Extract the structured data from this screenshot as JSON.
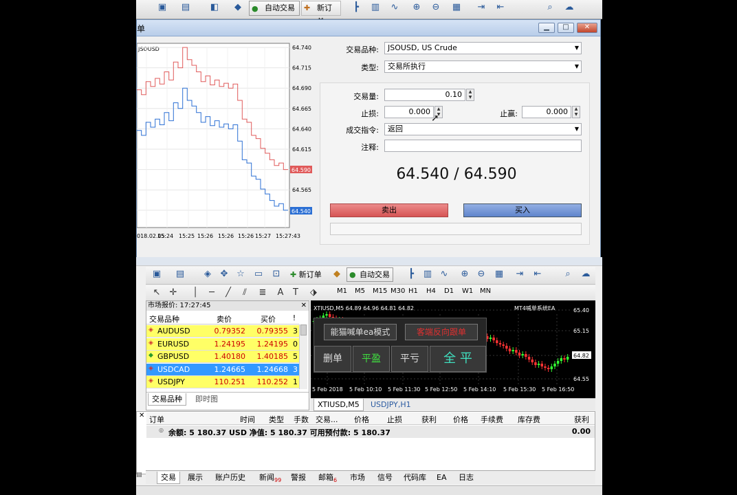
{
  "toolbar_top": {
    "autotrade": "自动交易",
    "new_order": "新订单"
  },
  "dialog": {
    "title": "单",
    "chart": {
      "symbol": "JSOUSD",
      "price_ticks": [
        "64.740",
        "64.715",
        "64.690",
        "64.665",
        "64.640",
        "64.615",
        "64.590",
        "64.565",
        "64.540"
      ],
      "time_ticks": [
        "018.02.05",
        "15:24",
        "15:25",
        "15:26",
        "15:26",
        "15:26",
        "15:27",
        "15:27:43"
      ],
      "bid_tag": "64.540",
      "ask_tag": "64.590"
    },
    "symbol_label": "交易品种:",
    "symbol_value": "JSOUSD, US Crude",
    "type_label": "类型:",
    "type_value": "交易所执行",
    "volume_label": "交易量:",
    "volume_value": "0.10",
    "sl_label": "止损:",
    "sl_value": "0.000",
    "tp_label": "止赢:",
    "tp_value": "0.000",
    "fill_label": "成交指令:",
    "fill_value": "返回",
    "comment_label": "注释:",
    "comment_value": "",
    "quote": "64.540 / 64.590",
    "sell_label": "卖出",
    "buy_label": "买入"
  },
  "terminal": {
    "toolbar": {
      "new_order": "新订单",
      "autotrade": "自动交易"
    },
    "timeframes": [
      "M1",
      "M5",
      "M15",
      "M30",
      "H1",
      "H4",
      "D1",
      "W1",
      "MN"
    ],
    "market_watch": {
      "title": "市场报价: 17:27:45",
      "headers": [
        "交易品种",
        "卖价",
        "买价",
        "!"
      ],
      "rows": [
        {
          "symbol": "AUDUSD",
          "bid": "0.79352",
          "ask": "0.79355",
          "spread": "3",
          "dir": "down"
        },
        {
          "symbol": "EURUSD",
          "bid": "1.24195",
          "ask": "1.24195",
          "spread": "0",
          "dir": "down"
        },
        {
          "symbol": "GBPUSD",
          "bid": "1.40180",
          "ask": "1.40185",
          "spread": "5",
          "dir": "up"
        },
        {
          "symbol": "USDCAD",
          "bid": "1.24665",
          "ask": "1.24668",
          "spread": "3",
          "dir": "down"
        },
        {
          "symbol": "USDJPY",
          "bid": "110.251",
          "ask": "110.252",
          "spread": "1",
          "dir": "down"
        }
      ],
      "tabs": [
        "交易品种",
        "即时图"
      ]
    },
    "chart": {
      "header": "XTIUSD,M5  64.89 64.96 64.81 64.82",
      "ea_label": "MT4喊单系统EA",
      "price_ticks": [
        "65.40",
        "65.15",
        "64.82",
        "64.55"
      ],
      "time_ticks": [
        "5 Feb 2018",
        "5 Feb 10:10",
        "5 Feb 11:30",
        "5 Feb 12:50",
        "5 Feb 14:10",
        "5 Feb 15:30",
        "5 Feb 16:50"
      ],
      "overlay": {
        "mode_btn": "能猫喊单ea模式",
        "reverse_btn": "客端反向跟单",
        "delete_btn": "删单",
        "profit_btn": "平盈",
        "loss_btn": "平亏",
        "all_close_btn": "全 平"
      },
      "tabs": [
        "XTIUSD,M5",
        "USDJPY,H1"
      ]
    },
    "orders": {
      "headers": [
        "订单",
        "时间",
        "类型",
        "手数",
        "交易...",
        "价格",
        "止损",
        "获利",
        "价格",
        "手续费",
        "库存费",
        "获利"
      ],
      "balance": "余额: 5 180.37 USD  净值: 5 180.37  可用预付款: 5 180.37",
      "balance_profit": "0.00"
    },
    "bottom_tabs": [
      "交易",
      "展示",
      "账户历史",
      "新闻",
      "警报",
      "邮箱",
      "市场",
      "信号",
      "代码库",
      "EA",
      "日志"
    ],
    "news_count": "99",
    "mail_count": "6"
  },
  "colors": {
    "sell": "#e06060",
    "buy": "#6c8fcf",
    "bid_line": "#2b6fd4",
    "ask_line": "#e05a5a",
    "highlight": "#ffff66",
    "selected": "#3399ff"
  }
}
